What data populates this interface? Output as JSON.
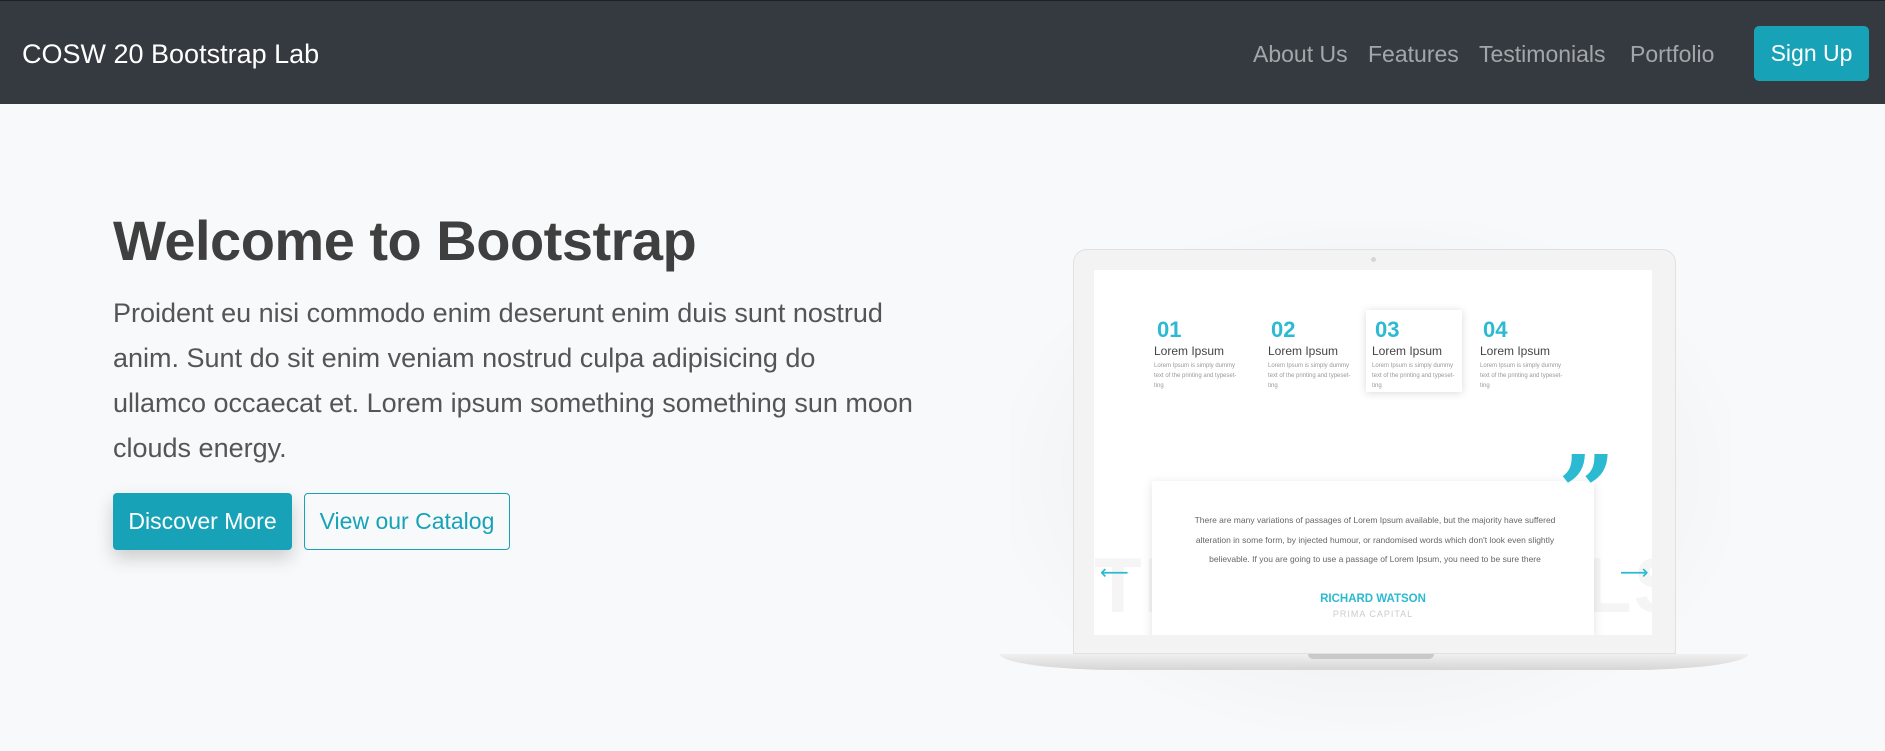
{
  "navbar": {
    "brand": "COSW 20 Bootstrap Lab",
    "links": [
      "About Us",
      "Features",
      "Testimonials",
      "Portfolio"
    ],
    "signup_label": "Sign Up",
    "background_color": "#343a40",
    "accent_color": "#17a2b8"
  },
  "hero": {
    "title": "Welcome to Bootstrap",
    "text": "Proident eu nisi commodo enim deserunt enim duis sunt nostrud anim. Sunt do sit enim veniam nostrud culpa adipisicing do ullamco occaecat et. Lorem ipsum something something sun moon clouds energy.",
    "primary_button": "Discover More",
    "secondary_button": "View our Catalog"
  },
  "mockup": {
    "bg_word_left": "TE",
    "bg_word_right": "LS",
    "steps": [
      {
        "number": "01",
        "title": "Lorem Ipsum",
        "desc": "Lorem Ipsum is simply dummy text of the printing and typeset-ting"
      },
      {
        "number": "02",
        "title": "Lorem Ipsum",
        "desc": "Lorem Ipsum is simply dummy text of the printing and typeset-ting"
      },
      {
        "number": "03",
        "title": "Lorem Ipsum",
        "desc": "Lorem Ipsum is simply dummy text of the printing and typeset-ting"
      },
      {
        "number": "04",
        "title": "Lorem Ipsum",
        "desc": "Lorem Ipsum is simply dummy text of the printing and typeset-ting"
      }
    ],
    "active_step": 3,
    "testimonial": {
      "text": "There are many variations of passages of Lorem Ipsum available, but the majority have suffered alteration in some form, by injected humour, or randomised words which don't look even slightly believable. If you are going to use a passage of Lorem Ipsum, you need to be sure there",
      "name": "RICHARD WATSON",
      "company": "PRIMA CAPITAL",
      "quote_glyph": "”",
      "prev_arrow": "⟵",
      "next_arrow": "⟶"
    }
  }
}
